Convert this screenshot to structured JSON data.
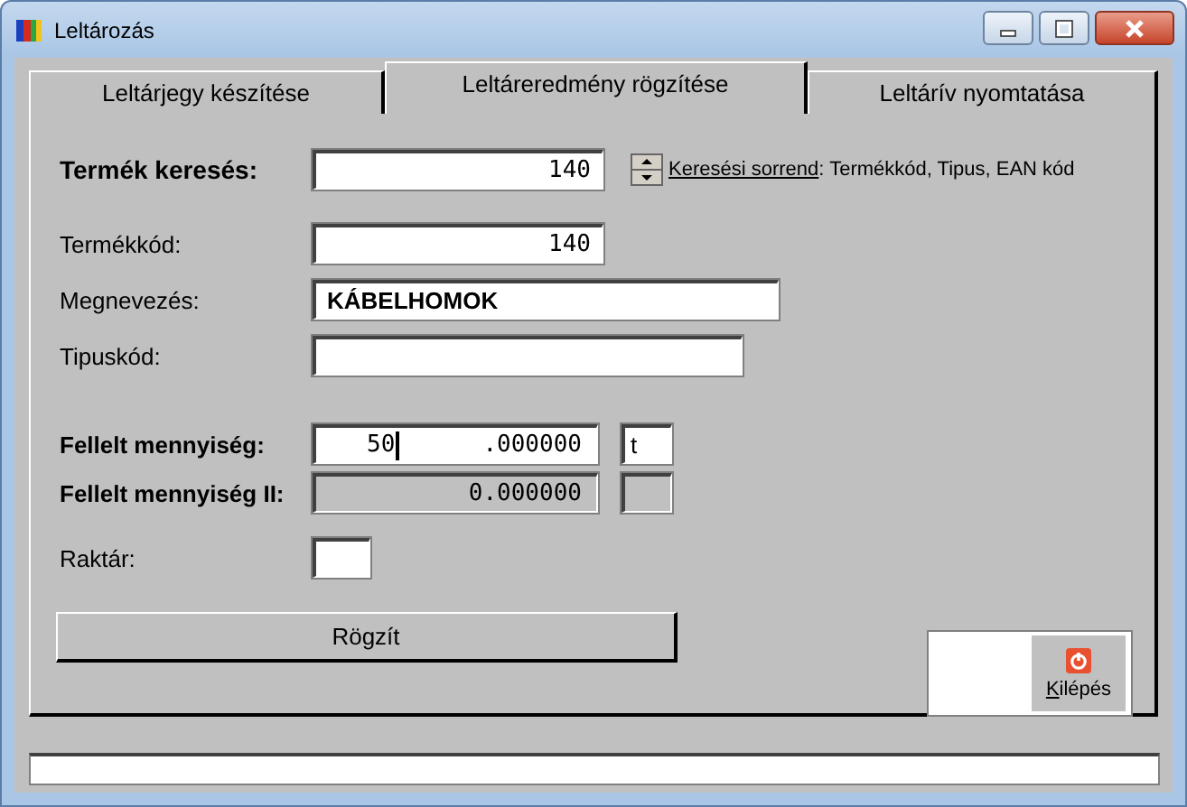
{
  "window": {
    "title": "Leltározás"
  },
  "tabs": [
    {
      "label": "Leltárjegy készítése",
      "selected": false
    },
    {
      "label": "Leltáreredmény rögzítése",
      "selected": true
    },
    {
      "label": "Leltárív nyomtatása",
      "selected": false
    }
  ],
  "search": {
    "label": "Termék keresés:",
    "value": "140",
    "order_link": "Keresési sorrend",
    "order_text": ": Termékkód, Tipus, EAN kód"
  },
  "fields": [
    {
      "label": "Termékkód:",
      "value": "140",
      "kind": "code"
    },
    {
      "label": "Megnevezés:",
      "value": "KÁBELHOMOK",
      "kind": "name"
    },
    {
      "label": "Tipuskód:",
      "kind": "type"
    }
  ],
  "quantities": [
    {
      "label": "Fellelt mennyiség:",
      "integer": "50",
      "fraction": ".000000",
      "unit": "t",
      "disabled": false,
      "focused": true
    },
    {
      "label": "Fellelt mennyiség II:",
      "fraction": "0.000000",
      "disabled": true,
      "focused": false
    }
  ],
  "warehouse": {
    "label": "Raktár:"
  },
  "save_button": "Rögzít",
  "exit_button": "Kilépés"
}
